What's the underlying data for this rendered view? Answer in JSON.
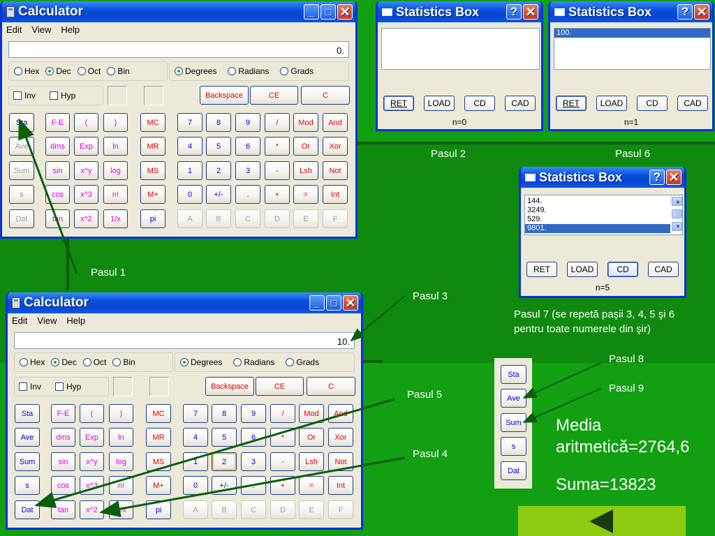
{
  "calc_top": {
    "title": "Calculator",
    "menu": [
      "Edit",
      "View",
      "Help"
    ],
    "display": "0.",
    "bases": [
      "Hex",
      "Dec",
      "Oct",
      "Bin"
    ],
    "angles": [
      "Degrees",
      "Radians",
      "Grads"
    ],
    "flags": [
      "Inv",
      "Hyp"
    ],
    "edit_buttons": [
      "Backspace",
      "CE",
      "C"
    ],
    "stat_buttons": [
      "Sta",
      "Ave",
      "Sum",
      "s",
      "Dat"
    ],
    "sci_rows": [
      [
        "F-E",
        "(",
        ")"
      ],
      [
        "dms",
        "Exp",
        "ln"
      ],
      [
        "sin",
        "x^y",
        "log"
      ],
      [
        "cos",
        "x^3",
        "n!"
      ],
      [
        "tan",
        "x^2",
        "1/x"
      ]
    ],
    "mem_buttons": [
      "MC",
      "MR",
      "MS",
      "M+",
      "pi"
    ],
    "pad_rows": [
      [
        "7",
        "8",
        "9",
        "/",
        "Mod",
        "And"
      ],
      [
        "4",
        "5",
        "6",
        "*",
        "Or",
        "Xor"
      ],
      [
        "1",
        "2",
        "3",
        "-",
        "Lsh",
        "Not"
      ],
      [
        "0",
        "+/-",
        ".",
        "+",
        "=",
        "Int"
      ],
      [
        "A",
        "B",
        "C",
        "D",
        "E",
        "F"
      ]
    ]
  },
  "calc_bottom": {
    "title": "Calculator",
    "menu": [
      "Edit",
      "View",
      "Help"
    ],
    "display": "10.",
    "bases": [
      "Hex",
      "Dec",
      "Oct",
      "Bin"
    ],
    "angles": [
      "Degrees",
      "Radians",
      "Grads"
    ],
    "flags": [
      "Inv",
      "Hyp"
    ],
    "edit_buttons": [
      "Backspace",
      "CE",
      "C"
    ],
    "stat_buttons": [
      "Sta",
      "Ave",
      "Sum",
      "s",
      "Dat"
    ],
    "sci_rows": [
      [
        "F-E",
        "(",
        ")"
      ],
      [
        "dms",
        "Exp",
        "ln"
      ],
      [
        "sin",
        "x^y",
        "log"
      ],
      [
        "cos",
        "x^3",
        "n!"
      ],
      [
        "tan",
        "x^2",
        "1/x"
      ]
    ],
    "mem_buttons": [
      "MC",
      "MR",
      "MS",
      "M+",
      "pi"
    ],
    "pad_rows": [
      [
        "7",
        "8",
        "9",
        "/",
        "Mod",
        "And"
      ],
      [
        "4",
        "5",
        "6",
        "*",
        "Or",
        "Xor"
      ],
      [
        "1",
        "2",
        "3",
        "-",
        "Lsh",
        "Not"
      ],
      [
        "0",
        "+/-",
        ".",
        "+",
        "=",
        "Int"
      ],
      [
        "A",
        "B",
        "C",
        "D",
        "E",
        "F"
      ]
    ]
  },
  "statbox_1": {
    "title": "Statistics Box",
    "items": [],
    "buttons": [
      "RET",
      "LOAD",
      "CD",
      "CAD"
    ],
    "count": "n=0"
  },
  "statbox_2": {
    "title": "Statistics Box",
    "items": [
      "100."
    ],
    "buttons": [
      "RET",
      "LOAD",
      "CD",
      "CAD"
    ],
    "count": "n=1"
  },
  "statbox_3": {
    "title": "Statistics Box",
    "items": [
      "144.",
      "3249.",
      "529.",
      "9801."
    ],
    "buttons": [
      "RET",
      "LOAD",
      "CD",
      "CAD"
    ],
    "count": "n=5"
  },
  "stat_strip": [
    "Sta",
    "Ave",
    "Sum",
    "s",
    "Dat"
  ],
  "labels": {
    "pasul_1": "Pasul 1",
    "pasul_2": "Pasul 2",
    "pasul_3": "Pasul 3",
    "pasul_4": "Pasul 4",
    "pasul_5": "Pasul 5",
    "pasul_6": "Pasul 6",
    "pasul_7_line1": "Pasul 7 (se repetă paşii 3, 4, 5 şi 6",
    "pasul_7_line2": "pentru toate numerele din şir)",
    "pasul_8": "Pasul 8",
    "pasul_9": "Pasul 9"
  },
  "results": {
    "media_line1": "Media",
    "media_line2": "aritmetică=2764,6",
    "suma": "Suma=13823"
  },
  "icons": {
    "calculator": "calculator-icon",
    "statbox": "window-icon",
    "help": "help-icon",
    "close": "close-icon",
    "minimize": "minimize-icon",
    "maximize": "maximize-icon",
    "back": "back-arrow-icon"
  },
  "colors": {
    "background": "#129f12",
    "arrow": "#0b5e0b",
    "title_bar": "#0a4fe0",
    "nav_bar": "#8ccc10"
  }
}
